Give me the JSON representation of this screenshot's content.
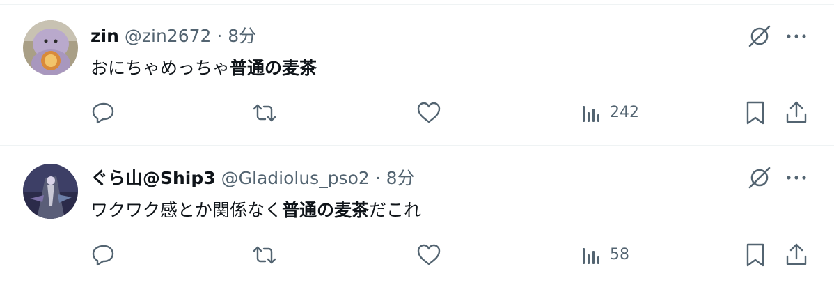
{
  "posts": [
    {
      "name": "zin",
      "handle": "@zin2672",
      "separator": "·",
      "time": "8分",
      "text_prefix": "おにちゃめっちゃ",
      "text_bold": "普通の麦茶",
      "text_suffix": "",
      "views": "242"
    },
    {
      "name": "ぐら山@Ship3",
      "handle": "@Gladiolus_pso2",
      "separator": "·",
      "time": "8分",
      "text_prefix": "ワクワク感とか関係なく",
      "text_bold": "普通の麦茶",
      "text_suffix": "だこれ",
      "views": "58"
    }
  ],
  "icons": {
    "reply": "reply-icon",
    "repost": "repost-icon",
    "like": "like-icon",
    "views": "views-icon",
    "bookmark": "bookmark-icon",
    "share": "share-icon",
    "grok": "grok-icon",
    "more": "more-icon"
  },
  "colors": {
    "text": "#0f1419",
    "secondary": "#536471",
    "divider": "#eff3f4"
  }
}
